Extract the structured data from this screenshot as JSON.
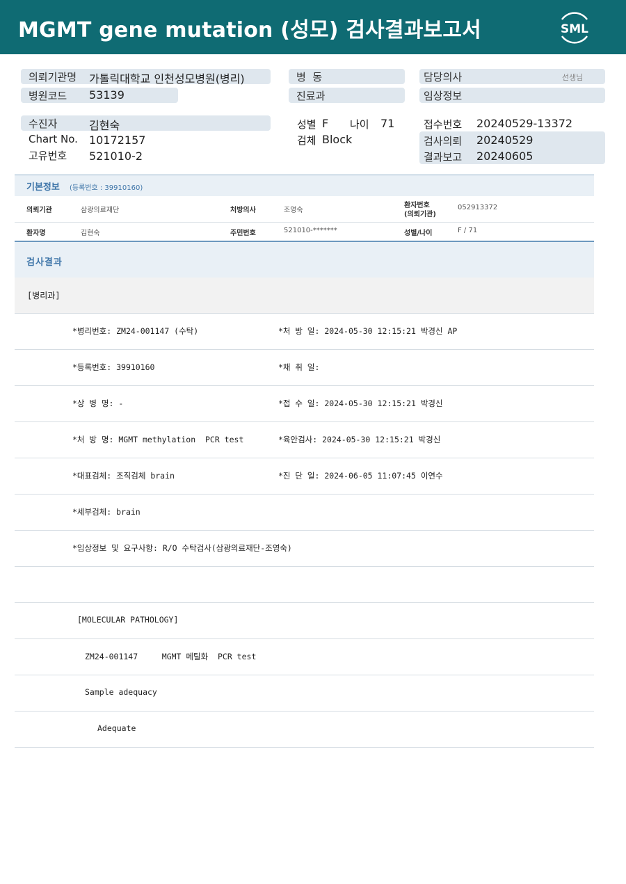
{
  "header": {
    "title": "MGMT gene mutation (성모) 검사결과보고서",
    "logo_text": "SML",
    "color": "#0f6b73"
  },
  "info": {
    "institution_label": "의뢰기관명",
    "institution_value": "가톨릭대학교 인천성모병원(병리)",
    "hospital_code_label": "병원코드",
    "hospital_code_value": "53139",
    "ward_label": "병  동",
    "dept_label": "진료과",
    "doctor_label": "담당의사",
    "doctor_suffix": "선생님",
    "clinical_label": "임상정보",
    "patient_label": "수진자",
    "patient_value": "김현숙",
    "chart_label": "Chart No.",
    "chart_value": "10172157",
    "unique_label": "고유번호",
    "unique_value": "521010-2",
    "sex_label": "성별",
    "sex_value": "F",
    "age_label": "나이",
    "age_value": "71",
    "specimen_label": "검체",
    "specimen_value": "Block",
    "receipt_label": "접수번호",
    "receipt_value": "20240529-13372",
    "request_label": "검사의뢰",
    "request_value": "20240529",
    "report_label": "결과보고",
    "report_value": "20240605"
  },
  "basic": {
    "title": "기본정보",
    "reg_label": "(등록번호 : 39910160)",
    "row1": {
      "inst_label": "의뢰기관",
      "inst_value": "삼광의료재단",
      "doc_label": "처방의사",
      "doc_value": "조영숙",
      "pt_no_label_1": "환자번호",
      "pt_no_label_2": "(의뢰기관)",
      "pt_no_value": "052913372"
    },
    "row2": {
      "name_label": "환자명",
      "name_value": "김현숙",
      "rrn_label": "주민번호",
      "rrn_value": "521010-*******",
      "sexage_label": "성별/나이",
      "sexage_value": "F / 71"
    }
  },
  "results": {
    "title": "검사결과",
    "dept": "[병리과]",
    "rows": [
      {
        "left": "*병리번호: ZM24-001147 (수탁)",
        "right": "*처 방 일: 2024-05-30 12:15:21  박경신 AP"
      },
      {
        "left": "*등록번호: 39910160",
        "right": "*채 취 일:"
      },
      {
        "left": "*상 병 명: -",
        "right": "*접 수 일: 2024-05-30 12:15:21  박경신"
      },
      {
        "left": "*처 방 명: MGMT methylation  PCR test",
        "right": "*육안검사: 2024-05-30 12:15:21  박경신"
      },
      {
        "left": "*대표검체: 조직검체 brain",
        "right": "*진 단 일: 2024-06-05 11:07:45  이연수"
      },
      {
        "left": "*세부검체: brain",
        "right": ""
      },
      {
        "left": "*임상정보 및 요구사항: R/O 수탁검사(삼광의료재단-조영숙)",
        "right": ""
      }
    ],
    "molecular": "[MOLECULAR PATHOLOGY]",
    "test_line": "ZM24-001147     MGMT 메틸화  PCR test",
    "sample_label": "Sample adequacy",
    "sample_value": "Adequate"
  }
}
